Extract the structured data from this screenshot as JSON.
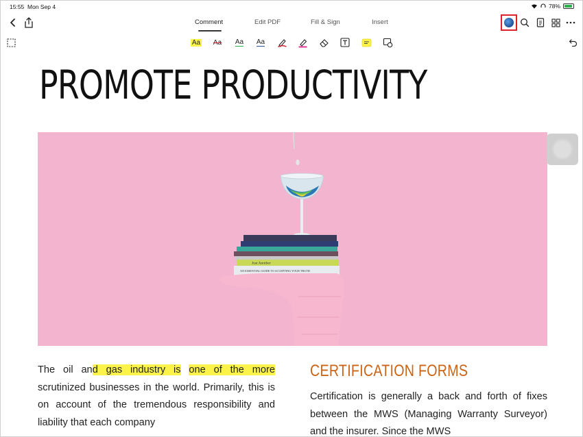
{
  "status": {
    "time": "15:55",
    "date": "Mon Sep 4",
    "battery": "78%"
  },
  "toolbar": {
    "tabs": [
      {
        "label": "Comment",
        "active": true
      },
      {
        "label": "Edit PDF",
        "active": false
      },
      {
        "label": "Fill & Sign",
        "active": false
      },
      {
        "label": "Insert",
        "active": false
      }
    ],
    "icons": [
      "back-icon",
      "share-icon",
      "avatar-icon",
      "search-icon",
      "pages-icon",
      "grid-icon",
      "more-icon"
    ]
  },
  "annotation_tools": {
    "text_sample": "Aa",
    "tools": [
      "marquee-select-icon",
      "highlight-text",
      "strikethrough-text",
      "underline-text",
      "squiggly-underline-text",
      "pen-icon",
      "highlighter-icon",
      "eraser-icon",
      "textbox-icon",
      "sticky-note-icon",
      "shape-icon",
      "undo-icon"
    ]
  },
  "document": {
    "title": "PROMOTE PRODUCTIVITY",
    "hero_image_colors": {
      "background": "#f2b4cf"
    },
    "hero_book_spines": [
      "Just Another",
      "AN ESSENTIAL GUIDE TO ACCEPTING YOUR TRUTH"
    ],
    "left_column": {
      "p1_before": "The oil an",
      "p1_mid": "d",
      "hl1": " gas industry is",
      "hl_gap": " ",
      "hl2": "one of the more",
      "p1_after": " scrutinized businesses in the world. Primarily, this is on account of the tremendous responsibility and liability that each company"
    },
    "right_column": {
      "heading": "CERTIFICATION FORMS",
      "text": "Certification is generally a back and forth of fixes between the MWS (Managing Warranty Surveyor) and the insurer. Since the MWS"
    }
  },
  "colors": {
    "accent_red": "#e0202a",
    "highlight": "#fbf34a",
    "heading_orange": "#cc6414"
  }
}
